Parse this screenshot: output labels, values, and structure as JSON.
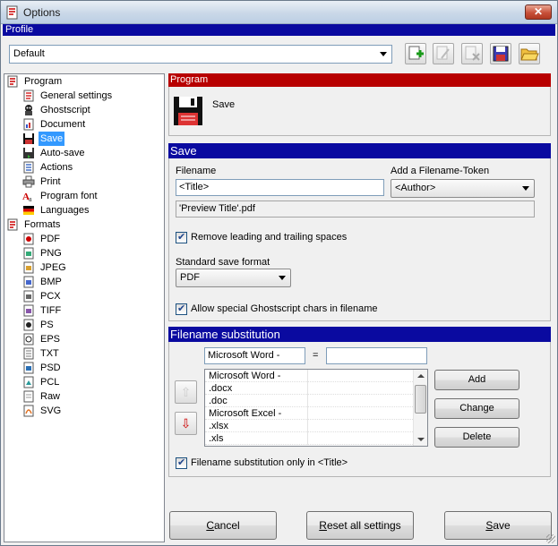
{
  "window": {
    "title": "Options",
    "close_glyph": "✕"
  },
  "profile": {
    "header": "Profile",
    "selected": "Default"
  },
  "toolbar": {
    "icons": [
      "add-profile-icon",
      "rename-profile-icon",
      "delete-profile-icon",
      "save-profile-icon",
      "open-profile-icon"
    ]
  },
  "tree": {
    "program": {
      "label": "Program",
      "items": [
        {
          "label": "General settings",
          "icon": "settings-doc-icon"
        },
        {
          "label": "Ghostscript",
          "icon": "ghostscript-icon"
        },
        {
          "label": "Document",
          "icon": "document-icon"
        },
        {
          "label": "Save",
          "icon": "floppy-disk-icon"
        },
        {
          "label": "Auto-save",
          "icon": "auto-save-icon"
        },
        {
          "label": "Actions",
          "icon": "actions-icon"
        },
        {
          "label": "Print",
          "icon": "printer-icon"
        },
        {
          "label": "Program font",
          "icon": "font-icon"
        },
        {
          "label": "Languages",
          "icon": "flag-icon"
        }
      ]
    },
    "formats": {
      "label": "Formats",
      "items": [
        "PDF",
        "PNG",
        "JPEG",
        "BMP",
        "PCX",
        "TIFF",
        "PS",
        "EPS",
        "TXT",
        "PSD",
        "PCL",
        "Raw",
        "SVG"
      ]
    }
  },
  "program_section": {
    "header": "Program",
    "label": "Save"
  },
  "save": {
    "header": "Save",
    "filename_label": "Filename",
    "filename_value": "<Title>",
    "token_label": "Add a Filename-Token",
    "token_value": "<Author>",
    "preview": "'Preview Title'.pdf",
    "remove_spaces": "Remove leading and trailing spaces",
    "format_label": "Standard save format",
    "format_value": "PDF",
    "allow_special": "Allow special Ghostscript chars in filename"
  },
  "substitution": {
    "header": "Filename substitution",
    "find": "Microsoft Word -",
    "equals": "=",
    "replace": "",
    "rows": [
      "Microsoft Word -",
      ".docx",
      ".doc",
      "Microsoft Excel -",
      ".xlsx",
      ".xls"
    ],
    "add": "Add",
    "change": "Change",
    "delete": "Delete",
    "title_only": "Filename substitution only in <Title>"
  },
  "footer": {
    "cancel": {
      "key": "C",
      "rest": "ancel"
    },
    "reset": {
      "key": "R",
      "rest": "eset all settings"
    },
    "save": {
      "key": "S",
      "rest": "ave"
    }
  }
}
